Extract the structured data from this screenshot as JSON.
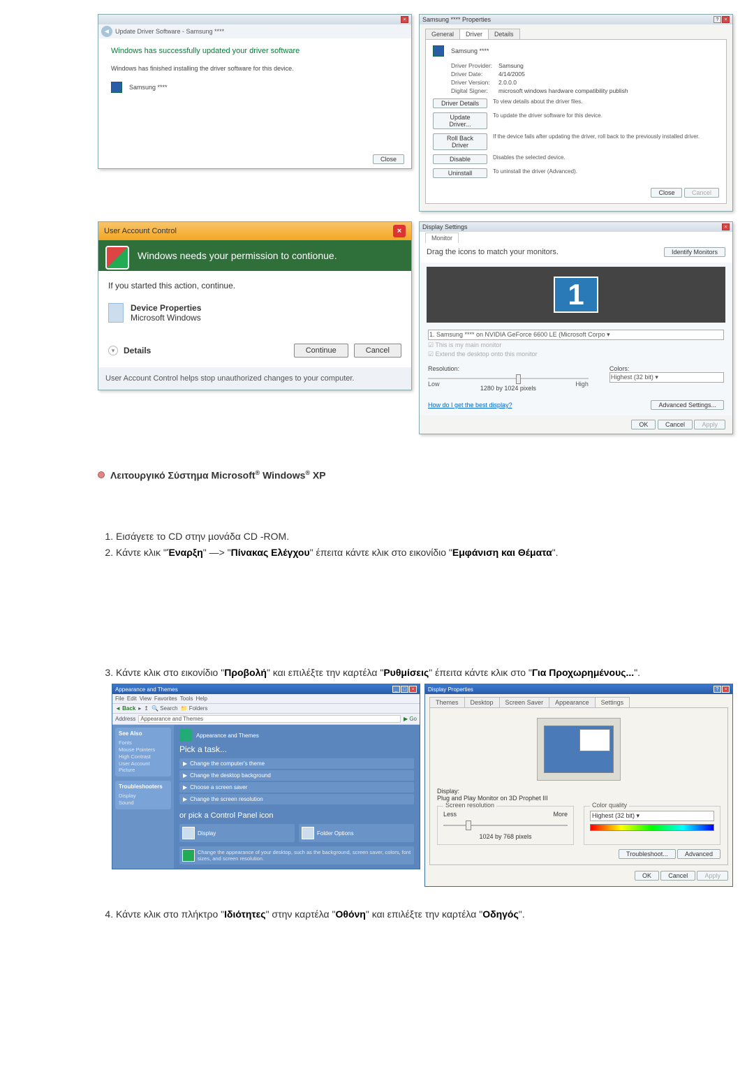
{
  "update_win": {
    "title": "Update Driver Software - Samsung ****",
    "msg1": "Windows has successfully updated your driver software",
    "msg2": "Windows has finished installing the driver software for this device.",
    "device": "Samsung ****",
    "close": "Close"
  },
  "props_win": {
    "title": "Samsung **** Properties",
    "tabs": {
      "general": "General",
      "driver": "Driver",
      "details": "Details"
    },
    "device": "Samsung ****",
    "kv": {
      "provider_k": "Driver Provider:",
      "provider_v": "Samsung",
      "date_k": "Driver Date:",
      "date_v": "4/14/2005",
      "version_k": "Driver Version:",
      "version_v": "2.0.0.0",
      "signer_k": "Digital Signer:",
      "signer_v": "microsoft windows hardware compatibility publish"
    },
    "btns": {
      "details": "Driver Details",
      "details_d": "To view details about the driver files.",
      "update": "Update Driver...",
      "update_d": "To update the driver software for this device.",
      "rollback": "Roll Back Driver",
      "rollback_d": "If the device fails after updating the driver, roll back to the previously installed driver.",
      "disable": "Disable",
      "disable_d": "Disables the selected device.",
      "uninstall": "Uninstall",
      "uninstall_d": "To uninstall the driver (Advanced)."
    },
    "close": "Close",
    "cancel": "Cancel"
  },
  "uac": {
    "title": "User Account Control",
    "banner": "Windows needs your permission to contionue.",
    "if_started": "If you started this action, continue.",
    "dev_props": "Device Properties",
    "ms_win": "Microsoft Windows",
    "details_btn": "Details",
    "continue": "Continue",
    "cancel": "Cancel",
    "foot": "User Account Control helps stop unauthorized changes to your computer."
  },
  "ds": {
    "title": "Display Settings",
    "tab": "Monitor",
    "drag": "Drag the icons to match your monitors.",
    "identify": "Identify Monitors",
    "mon_num": "1",
    "display_sel": "1. Samsung **** on NVIDIA GeForce 6600 LE (Microsoft Corpo",
    "chk1": "This is my main monitor",
    "chk2": "Extend the desktop onto this monitor",
    "res_label": "Resolution:",
    "low": "Low",
    "high": "High",
    "res_val": "1280 by 1024 pixels",
    "colors_label": "Colors:",
    "colors_val": "Highest (32 bit)",
    "link": "How do I get the best display?",
    "adv": "Advanced Settings...",
    "ok": "OK",
    "cancel": "Cancel",
    "apply": "Apply"
  },
  "os_heading": "Λειτουργικό Σύστημα Microsoft® Windows® XP",
  "steps12": {
    "s1": "Εισάγετε το CD στην µονάδα CD -ROM.",
    "s2a": "Κάντε κλικ \"",
    "s2_start": "Έναρξη",
    "s2b": "\" —> \"",
    "s2_cp": "Πίνακας Ελέγχου",
    "s2c": "\" έπειτα κάντε κλικ στο εικονίδιο \"",
    "s2_appearance": "Εμφάνιση και Θέματα",
    "s2d": "\"."
  },
  "steps34": {
    "s3a": "Κάντε κλικ στο εικονίδιο \"",
    "s3_display": "Προβολή",
    "s3b": "\" και επιλέξτε την καρτέλα \"",
    "s3_settings": "Ρυθμίσεις",
    "s3c": "\" έπειτα κάντε κλικ στο \"",
    "s3_adv": "Για Προχωρημένους...",
    "s3d": "\".",
    "s4a": "Κάντε κλικ στο πλήκτρο \"",
    "s4_props": "Ιδιότητες",
    "s4b": "\" στην καρτέλα \"",
    "s4_monitor": "Οθόνη",
    "s4c": "\" και επιλέξτε την καρτέλα \"",
    "s4_driver": "Οδηγός",
    "s4d": "\"."
  },
  "xp": {
    "title": "Appearance and Themes",
    "menu": {
      "file": "File",
      "edit": "Edit",
      "view": "View",
      "fav": "Favorites",
      "tools": "Tools",
      "help": "Help"
    },
    "tb": {
      "back": "Back",
      "search": "Search",
      "folders": "Folders"
    },
    "addr_label": "Address",
    "addr_val": "Appearance and Themes",
    "go": "Go",
    "left": {
      "see_also": "See Also",
      "sa1": "Fonts",
      "sa2": "Mouse Pointers",
      "sa3": "High Contrast",
      "sa4": "User Account Picture",
      "trouble": "Troubleshooters",
      "t1": "Display",
      "t2": "Sound"
    },
    "right": {
      "banner": "Appearance and Themes",
      "pick_task": "Pick a task...",
      "t1": "Change the computer's theme",
      "t2": "Change the desktop background",
      "t3": "Choose a screen saver",
      "t4": "Change the screen resolution",
      "or_pick": "or pick a Control Panel icon",
      "c1": "Display",
      "c2": "Folder Options",
      "note": "Change the appearance of your desktop, such as the background, screen saver, colors, font sizes, and screen resolution."
    }
  },
  "dp": {
    "title": "Display Properties",
    "tabs": {
      "themes": "Themes",
      "desktop": "Desktop",
      "ss": "Screen Saver",
      "appearance": "Appearance",
      "settings": "Settings"
    },
    "display_label": "Display:",
    "display_val": "Plug and Play Monitor on 3D Prophet III",
    "res_legend": "Screen resolution",
    "less": "Less",
    "more": "More",
    "res_val": "1024 by 768 pixels",
    "cq_legend": "Color quality",
    "cq_val": "Highest (32 bit)",
    "troubleshoot": "Troubleshoot...",
    "advanced": "Advanced",
    "ok": "OK",
    "cancel": "Cancel",
    "apply": "Apply"
  }
}
